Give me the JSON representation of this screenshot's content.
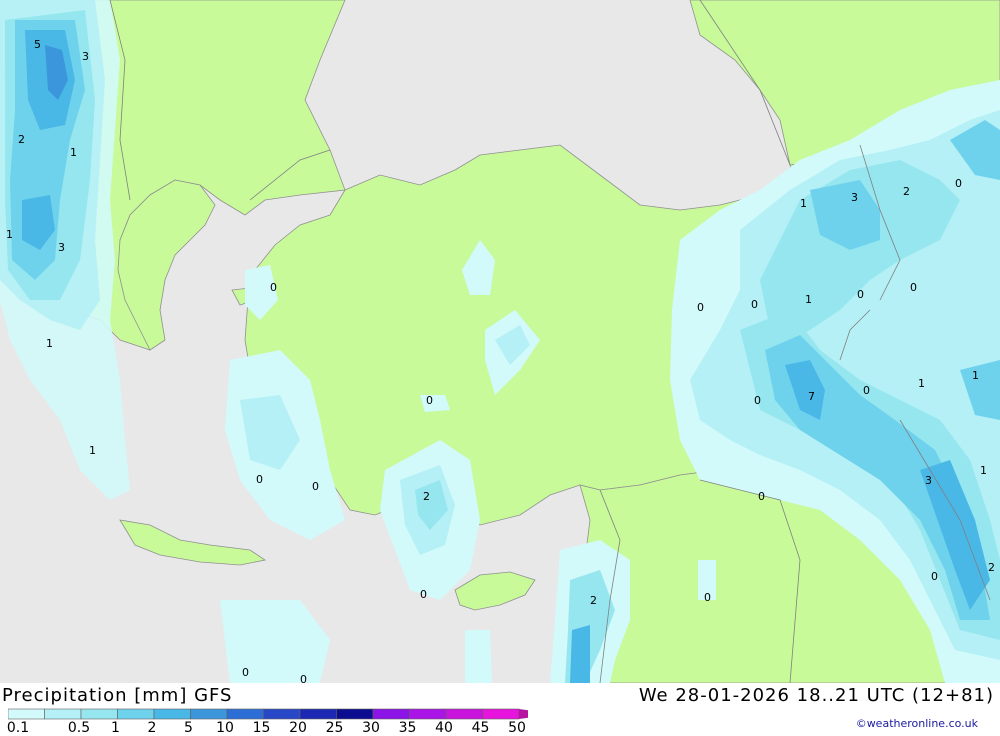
{
  "title": "Precipitation [mm] GFS",
  "timestamp": "We 28-01-2026 18..21 UTC (12+81)",
  "credit": "©weatheronline.co.uk",
  "colors": {
    "sea": "#e8e8e8",
    "land": "#c8fa9a",
    "border": "#909090",
    "p0_1": "#d2fafa",
    "p0_5": "#b4f0f5",
    "p1": "#96e6f0",
    "p2": "#6ed2ec",
    "p5": "#4ab8e6",
    "p10": "#3c96dc"
  },
  "legend": {
    "colors": [
      "#d2fafa",
      "#b4f0f5",
      "#96e6f0",
      "#6ed2ec",
      "#4ab8e6",
      "#3c96dc",
      "#2c6ed6",
      "#2848c8",
      "#1c28b4",
      "#0c0c90",
      "#8c14e6",
      "#aa14e6",
      "#c814dc",
      "#e614dc",
      "#d214b4",
      "#b414a0"
    ],
    "ticks": [
      "0.1",
      "0.5",
      "1",
      "2",
      "5",
      "10",
      "15",
      "20",
      "25",
      "30",
      "35",
      "40",
      "45",
      "50"
    ]
  },
  "map_labels": [
    "5",
    "3",
    "2",
    "1",
    "1",
    "3",
    "0",
    "1",
    "1",
    "0",
    "0",
    "0",
    "2",
    "0",
    "0",
    "0",
    "0",
    "0",
    "1",
    "0",
    "7",
    "0",
    "0",
    "1",
    "3",
    "2",
    "0",
    "0",
    "1",
    "1",
    "3",
    "0",
    "2",
    "1",
    "2",
    "0",
    "0"
  ]
}
